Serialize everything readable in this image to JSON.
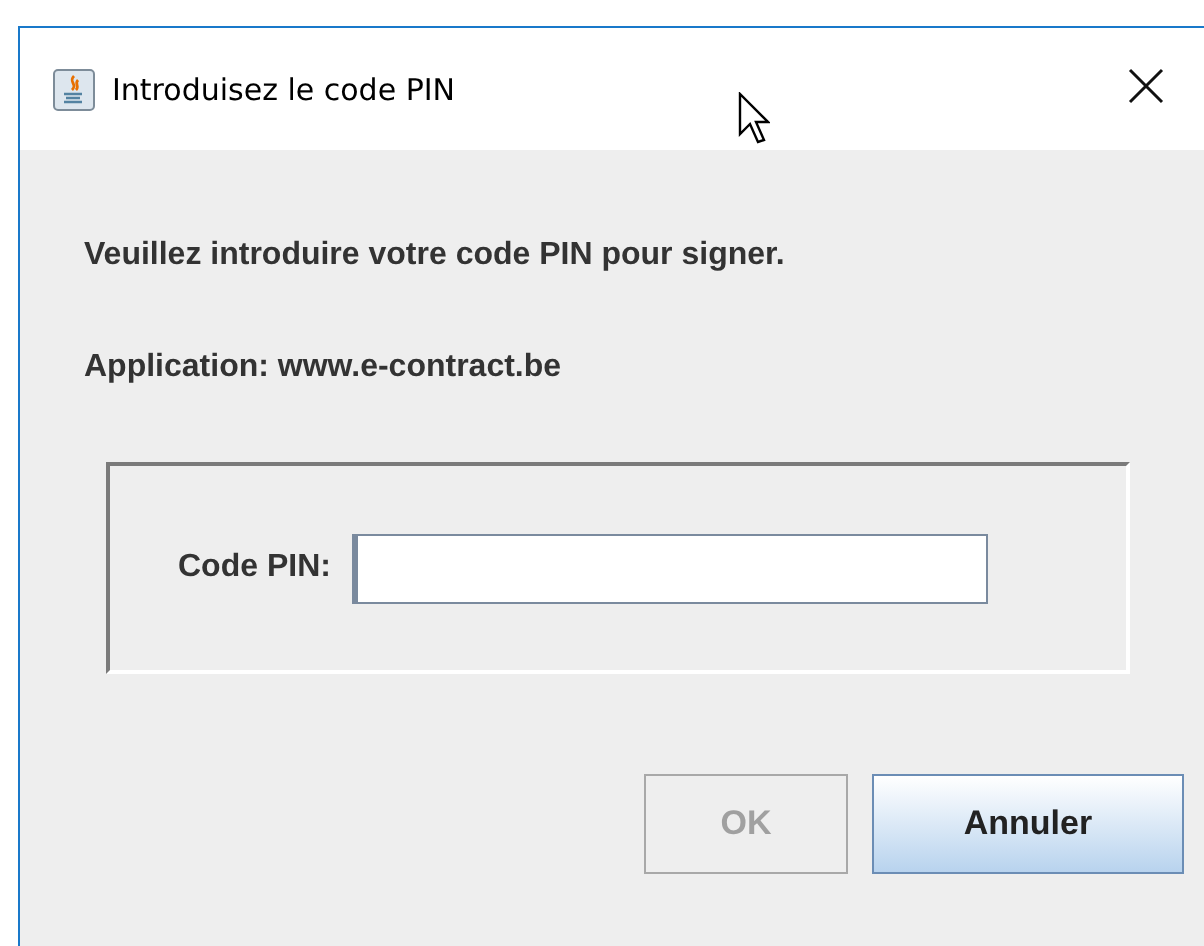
{
  "window": {
    "title": "Introduisez le code PIN"
  },
  "message": "Veuillez introduire votre code PIN pour signer.",
  "application": "Application: www.e-contract.be",
  "pin_field": {
    "label": "Code PIN:"
  },
  "buttons": [
    {
      "label": "OK",
      "disabled": true,
      "focused": false
    },
    {
      "label": "Annuler",
      "disabled": false,
      "focused": true
    }
  ]
}
